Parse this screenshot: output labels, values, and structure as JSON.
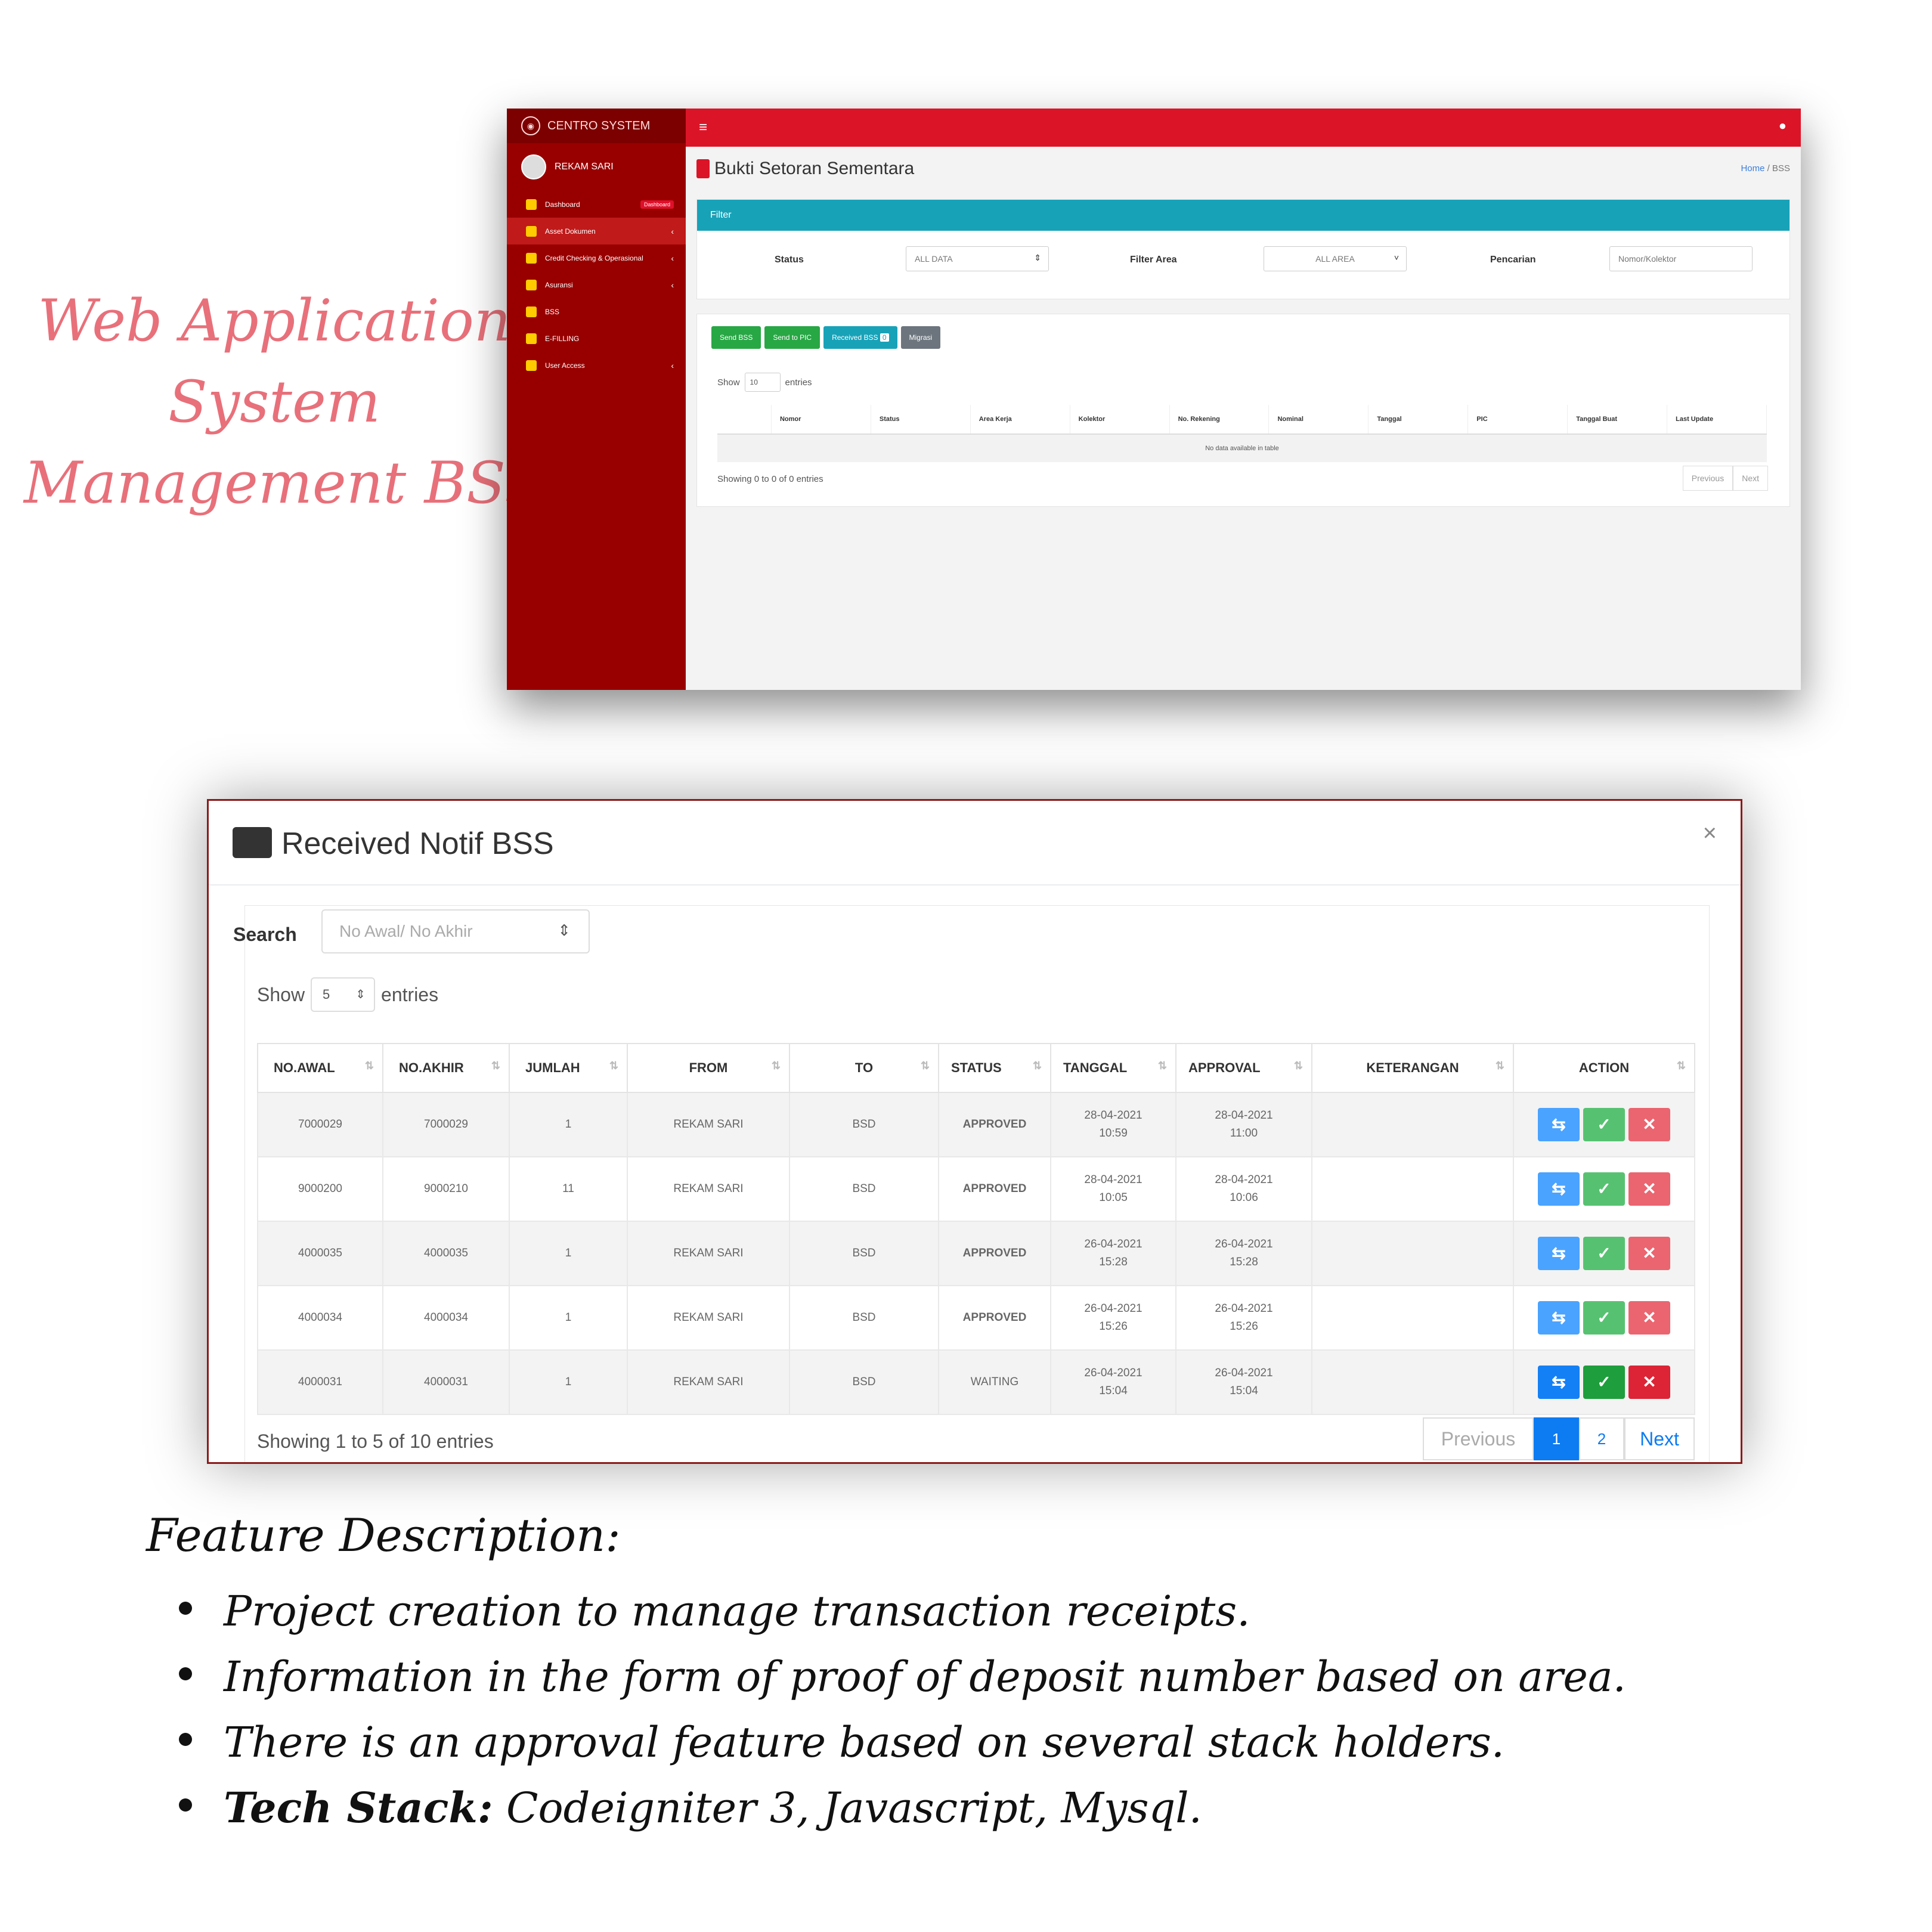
{
  "promo": {
    "title_lines": [
      "Web Application",
      "System",
      "Management BSS"
    ]
  },
  "app_main": {
    "brand": "CENTRO SYSTEM",
    "user": "REKAM SARI",
    "sidebar": [
      {
        "label": "Dashboard",
        "badge": "Dashboard"
      },
      {
        "label": "Asset Dokumen"
      },
      {
        "label": "Credit Checking & Operasional"
      },
      {
        "label": "Asuransi"
      },
      {
        "label": "BSS"
      },
      {
        "label": "E-FILLING"
      },
      {
        "label": "User Access"
      }
    ],
    "page_title": "Bukti Setoran Sementara",
    "breadcrumb": {
      "home": "Home",
      "sep": "/",
      "current": "BSS"
    },
    "filter": {
      "header": "Filter",
      "status_label": "Status",
      "status_value": "ALL DATA",
      "area_label": "Filter Area",
      "area_value": "ALL AREA",
      "search_label": "Pencarian",
      "search_placeholder": "Nomor/Kolektor"
    },
    "buttons": [
      "Send BSS",
      "Send to PIC",
      "Received BSS",
      "Migrasi"
    ],
    "received_count": "0",
    "show_label": "Show",
    "show_value": "10",
    "entries_label": "entries",
    "columns": [
      "Nomor",
      "Status",
      "Area Kerja",
      "Kolektor",
      "No. Rekening",
      "Nominal",
      "Tanggal",
      "PIC",
      "Tanggal Buat",
      "Last Update"
    ],
    "empty_text": "No data available in table",
    "showing_text": "Showing 0 to 0 of 0 entries",
    "prev": "Previous",
    "next": "Next"
  },
  "modal": {
    "title": "Received Notif BSS",
    "close": "×",
    "search_label": "Search",
    "search_placeholder": "No Awal/ No Akhir",
    "show_label": "Show",
    "show_value": "5",
    "entries_label": "entries",
    "columns": [
      "NO.AWAL",
      "NO.AKHIR",
      "JUMLAH",
      "FROM",
      "TO",
      "STATUS",
      "TANGGAL",
      "APPROVAL",
      "KETERANGAN",
      "ACTION"
    ],
    "rows": [
      {
        "no_awal": "7000029",
        "no_akhir": "7000029",
        "jumlah": "1",
        "from": "REKAM SARI",
        "to": "BSD",
        "status": "APPROVED",
        "tanggal_date": "28-04-2021",
        "tanggal_time": "10:59",
        "approval_date": "28-04-2021",
        "approval_time": "11:00",
        "keterangan": ""
      },
      {
        "no_awal": "9000200",
        "no_akhir": "9000210",
        "jumlah": "11",
        "from": "REKAM SARI",
        "to": "BSD",
        "status": "APPROVED",
        "tanggal_date": "28-04-2021",
        "tanggal_time": "10:05",
        "approval_date": "28-04-2021",
        "approval_time": "10:06",
        "keterangan": ""
      },
      {
        "no_awal": "4000035",
        "no_akhir": "4000035",
        "jumlah": "1",
        "from": "REKAM SARI",
        "to": "BSD",
        "status": "APPROVED",
        "tanggal_date": "26-04-2021",
        "tanggal_time": "15:28",
        "approval_date": "26-04-2021",
        "approval_time": "15:28",
        "keterangan": ""
      },
      {
        "no_awal": "4000034",
        "no_akhir": "4000034",
        "jumlah": "1",
        "from": "REKAM SARI",
        "to": "BSD",
        "status": "APPROVED",
        "tanggal_date": "26-04-2021",
        "tanggal_time": "15:26",
        "approval_date": "26-04-2021",
        "approval_time": "15:26",
        "keterangan": ""
      },
      {
        "no_awal": "4000031",
        "no_akhir": "4000031",
        "jumlah": "1",
        "from": "REKAM SARI",
        "to": "BSD",
        "status": "WAITING",
        "tanggal_date": "26-04-2021",
        "tanggal_time": "15:04",
        "approval_date": "26-04-2021",
        "approval_time": "15:04",
        "keterangan": ""
      }
    ],
    "showing_text": "Showing 1 to 5 of 10 entries",
    "prev": "Previous",
    "pages": [
      "1",
      "2"
    ],
    "next": "Next"
  },
  "features": {
    "title": "Feature Description:",
    "items": [
      {
        "bold": "",
        "text": "Project creation to manage transaction receipts."
      },
      {
        "bold": "",
        "text": "Information in the form of proof of deposit number based on area."
      },
      {
        "bold": "",
        "text": "There is an approval feature based on several stack holders."
      },
      {
        "bold": "Tech Stack:",
        "text": " Codeigniter 3, Javascript, Mysql."
      }
    ]
  },
  "colors": {
    "accent_red": "#dc1428",
    "sidebar_red": "#980000",
    "filter_teal": "#17a2b8",
    "title_pink": "#e8707a",
    "approved_green": "#28a745",
    "page_blue": "#0d7bf2"
  }
}
